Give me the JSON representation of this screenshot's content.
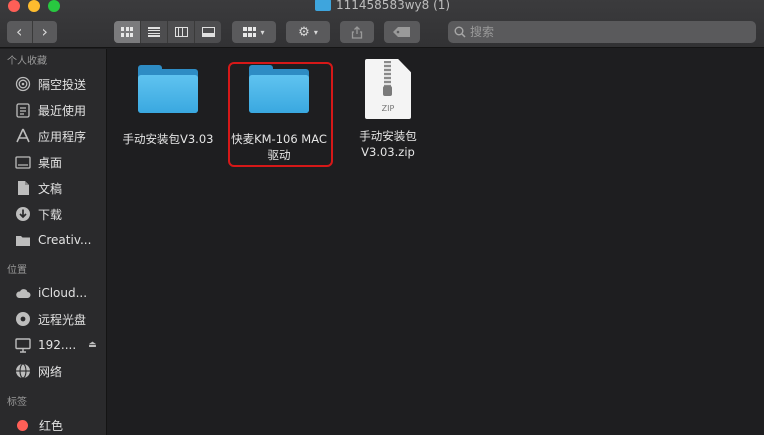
{
  "window": {
    "title": "111458583wy8 (1)"
  },
  "toolbar": {
    "back": "‹",
    "forward": "›",
    "arrange_caret": "▾",
    "action_caret": "▾"
  },
  "search": {
    "placeholder": "搜索"
  },
  "sidebar": {
    "favorites_header": "个人收藏",
    "favorites": [
      {
        "label": "隔空投送",
        "icon": "airdrop-icon"
      },
      {
        "label": "最近使用",
        "icon": "recents-icon"
      },
      {
        "label": "应用程序",
        "icon": "applications-icon"
      },
      {
        "label": "桌面",
        "icon": "desktop-icon"
      },
      {
        "label": "文稿",
        "icon": "documents-icon"
      },
      {
        "label": "下载",
        "icon": "downloads-icon"
      },
      {
        "label": "Creativ...",
        "icon": "folder-icon"
      }
    ],
    "locations_header": "位置",
    "locations": [
      {
        "label": "iCloud...",
        "icon": "icloud-icon"
      },
      {
        "label": "远程光盘",
        "icon": "disc-icon"
      },
      {
        "label": "192....",
        "icon": "computer-icon"
      },
      {
        "label": "网络",
        "icon": "network-icon"
      }
    ],
    "tags_header": "标签",
    "tags": [
      {
        "label": "红色",
        "color": "#fe5f57"
      }
    ]
  },
  "files": [
    {
      "name": "手动安装包V3.03",
      "kind": "folder"
    },
    {
      "name": "快麦KM-106 MAC驱动",
      "name_line1": "快麦KM-106 MAC",
      "name_line2": "驱动",
      "kind": "folder",
      "highlighted": true
    },
    {
      "name": "手动安装包V3.03.zip",
      "name_line1": "手动安装包",
      "name_line2": "V3.03.zip",
      "kind": "zip",
      "badge": "ZIP"
    }
  ],
  "colors": {
    "accent_folder": "#3aa8e0",
    "highlight": "#d61818"
  }
}
